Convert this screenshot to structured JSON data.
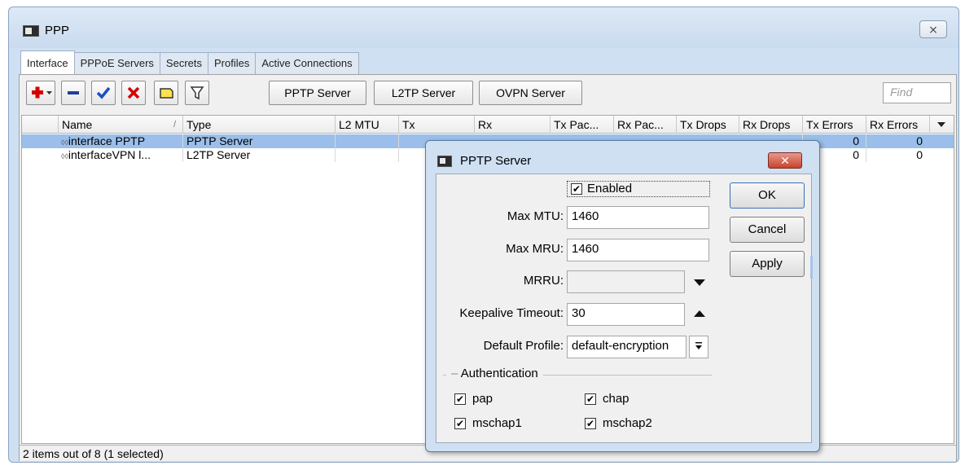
{
  "window": {
    "title": "PPP",
    "close_glyph": "⨯"
  },
  "tabs": [
    {
      "label": "Interface",
      "active": true
    },
    {
      "label": "PPPoE Servers",
      "active": false
    },
    {
      "label": "Secrets",
      "active": false
    },
    {
      "label": "Profiles",
      "active": false
    },
    {
      "label": "Active Connections",
      "active": false
    }
  ],
  "toolbar": {
    "pptp_label": "PPTP Server",
    "l2tp_label": "L2TP Server",
    "ovpn_label": "OVPN Server",
    "find_placeholder": "Find"
  },
  "table": {
    "columns": [
      "Name",
      "Type",
      "L2 MTU",
      "Tx",
      "Rx",
      "Tx Pac...",
      "Rx Pac...",
      "Tx Drops",
      "Rx Drops",
      "Tx Errors",
      "Rx Errors"
    ],
    "sort_indicator": "/",
    "rows": [
      {
        "name": "interface PPTP",
        "type": "PPTP Server",
        "tx_errors": "0",
        "rx_errors": "0",
        "selected": true
      },
      {
        "name": "interfaceVPN l...",
        "type": "L2TP Server",
        "tx_errors": "0",
        "rx_errors": "0",
        "selected": false
      }
    ],
    "row_icon": "◊◊"
  },
  "status": "2 items out of 8 (1 selected)",
  "dialog": {
    "title": "PPTP Server",
    "close_glyph": "✕",
    "enabled_label": "Enabled",
    "max_mtu_label": "Max MTU:",
    "max_mtu_value": "1460",
    "max_mru_label": "Max MRU:",
    "max_mru_value": "1460",
    "mrru_label": "MRRU:",
    "mrru_value": "",
    "keepalive_label": "Keepalive Timeout:",
    "keepalive_value": "30",
    "profile_label": "Default Profile:",
    "profile_value": "default-encryption",
    "auth_label": "Authentication",
    "auth": [
      {
        "label": "pap",
        "checked": true
      },
      {
        "label": "chap",
        "checked": true
      },
      {
        "label": "mschap1",
        "checked": true
      },
      {
        "label": "mschap2",
        "checked": true
      }
    ],
    "ok_label": "OK",
    "cancel_label": "Cancel",
    "apply_label": "Apply"
  },
  "colors": {
    "selection": "#9bbfea",
    "add_red": "#d40000",
    "check_blue": "#1b4fc4",
    "close_red": "#c8432c"
  }
}
